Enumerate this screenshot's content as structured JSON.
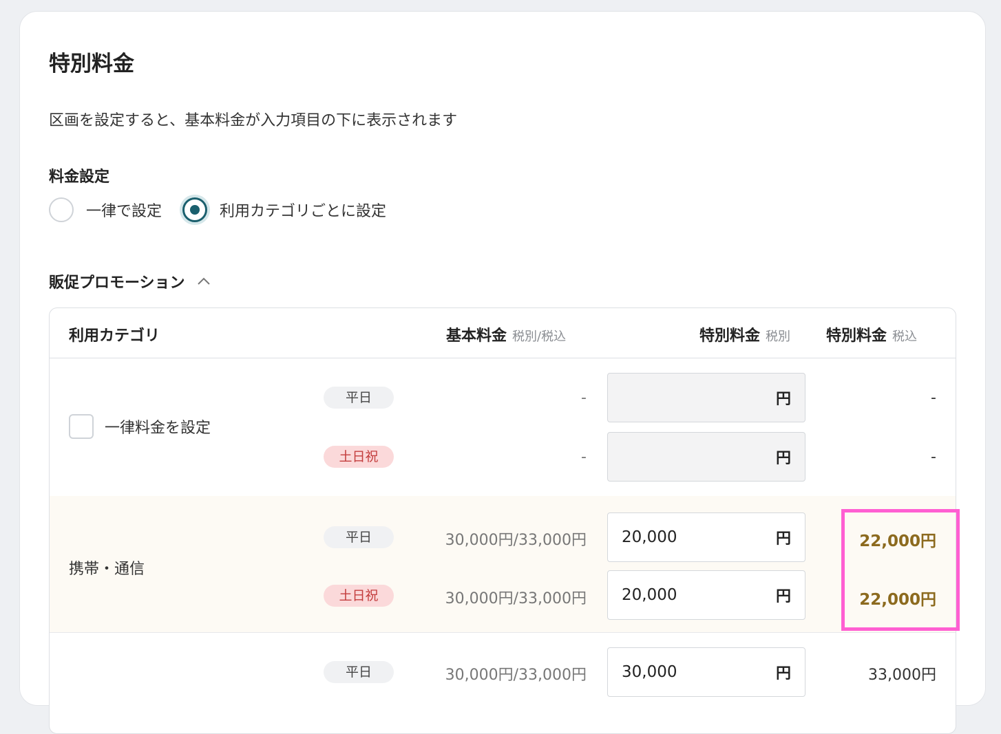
{
  "card": {
    "title": "特別料金",
    "description": "区画を設定すると、基本料金が入力項目の下に表示されます",
    "pricing_label": "料金設定",
    "radio_options": [
      {
        "label": "一律で設定",
        "selected": false
      },
      {
        "label": "利用カテゴリごとに設定",
        "selected": true
      }
    ],
    "promo_section": "販促プロモーション",
    "colors": {
      "accent": "#1a5f6d",
      "weekend_pill_bg": "#fbd9da",
      "weekend_pill_text": "#c33d3d",
      "highlight_value": "#8c6a1e",
      "highlight_border": "#ff5fd2"
    }
  },
  "table": {
    "headers": {
      "category": "利用カテゴリ",
      "base": "基本料金",
      "base_note": "税別/税込",
      "special_ex": "特別料金",
      "special_ex_note": "税別",
      "special_in": "特別料金",
      "special_in_note": "税込"
    },
    "unit": "円",
    "rows": [
      {
        "category": "一律料金を設定",
        "checkbox": true,
        "weekday": {
          "pill": "平日",
          "base": "-",
          "input": "",
          "tax": "-"
        },
        "weekend": {
          "pill": "土日祝",
          "base": "-",
          "input": "",
          "tax": "-"
        }
      },
      {
        "category": "携帯・通信",
        "weekday": {
          "pill": "平日",
          "base": "30,000円/33,000円",
          "input": "20,000",
          "tax": "22,000円"
        },
        "weekend": {
          "pill": "土日祝",
          "base": "30,000円/33,000円",
          "input": "20,000",
          "tax": "22,000円"
        }
      },
      {
        "category": "",
        "weekday": {
          "pill": "平日",
          "base": "30,000円/33,000円",
          "input": "30,000",
          "tax": "33,000円"
        }
      }
    ]
  }
}
